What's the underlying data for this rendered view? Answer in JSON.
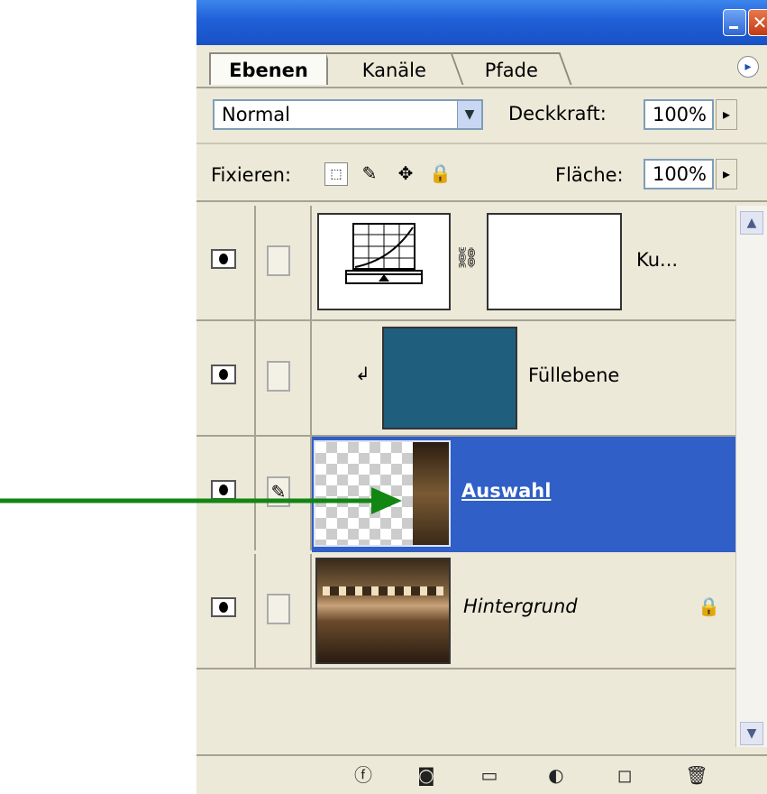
{
  "window": {
    "minimize_icon": "minimize-icon",
    "close_icon": "close-icon",
    "close_glyph": "✕"
  },
  "tabs": [
    {
      "label": "Ebenen",
      "active": true
    },
    {
      "label": "Kanäle",
      "active": false
    },
    {
      "label": "Pfade",
      "active": false
    }
  ],
  "panel_menu_glyph": "▸",
  "blend": {
    "mode": "Normal",
    "dropdown_glyph": "▼"
  },
  "opacity": {
    "label": "Deckkraft:",
    "value": "100%",
    "arrow": "▸"
  },
  "lock": {
    "label": "Fixieren:",
    "icons": [
      "lock-transparent-icon",
      "lock-brush-icon",
      "lock-move-icon",
      "lock-all-icon"
    ],
    "glyphs": [
      "⬚",
      "✎",
      "✥",
      "🔒"
    ]
  },
  "fill": {
    "label": "Fläche:",
    "value": "100%",
    "arrow": "▸"
  },
  "layers": [
    {
      "name": "Ku...",
      "type": "adjustment"
    },
    {
      "name": "Füllebene",
      "type": "fill",
      "color": "#1f5e7c",
      "clip_glyph": "↲"
    },
    {
      "name": "Auswahl",
      "type": "image",
      "selected": true
    },
    {
      "name": "Hintergrund",
      "type": "background",
      "locked": true,
      "lock_glyph": "🔒"
    }
  ],
  "link_glyph": "⛓",
  "scroll": {
    "up": "▲",
    "down": "▼"
  },
  "bottom_icons": [
    {
      "name": "layer-style-icon",
      "glyph": "ⓕ"
    },
    {
      "name": "add-mask-icon",
      "glyph": "◙"
    },
    {
      "name": "new-group-icon",
      "glyph": "▭"
    },
    {
      "name": "adjustment-layer-icon",
      "glyph": "◐"
    },
    {
      "name": "new-layer-icon",
      "glyph": "◻"
    },
    {
      "name": "trash-icon",
      "glyph": "🗑"
    }
  ],
  "colors": {
    "annotation_arrow": "#128612",
    "selection": "#2f5fc7"
  }
}
